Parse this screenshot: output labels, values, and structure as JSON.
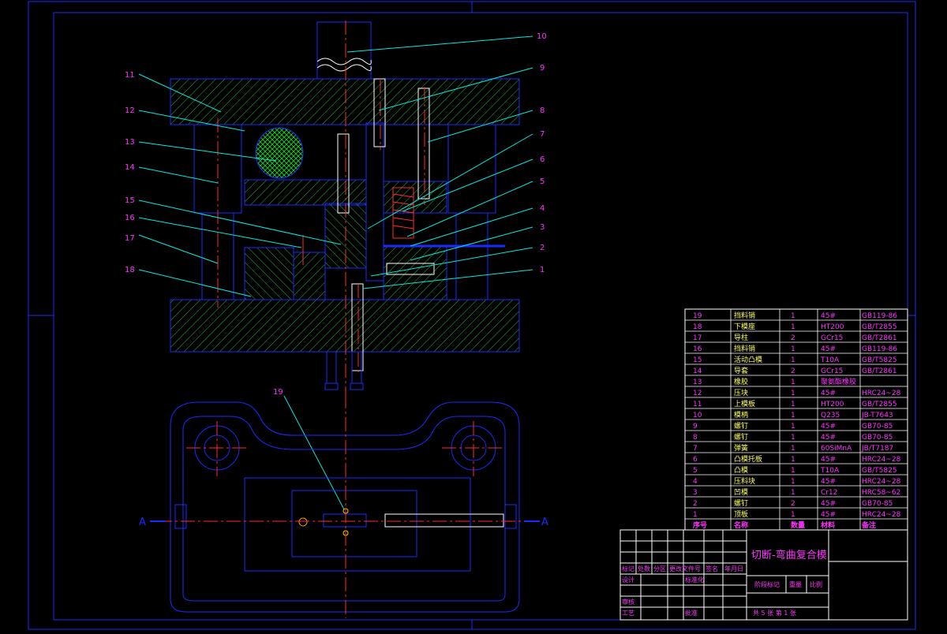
{
  "colors": {
    "background": "#000000",
    "frame": "#1a2bff",
    "hatch_green": "#22c02a",
    "leader": "#00e8e0",
    "label": "#ff33ff",
    "center_line": "#ff2a2a",
    "table_text_yellow": "#ffff66",
    "white": "#ffffff"
  },
  "callouts": [
    "1",
    "2",
    "3",
    "4",
    "5",
    "6",
    "7",
    "8",
    "9",
    "10",
    "11",
    "12",
    "13",
    "14",
    "15",
    "16",
    "17",
    "18",
    "19"
  ],
  "section_marks": {
    "left": "A",
    "right": "A"
  },
  "bom": {
    "header": {
      "no": "序号",
      "name": "名称",
      "qty": "数量",
      "material": "材料",
      "remark": "备注"
    },
    "rows": [
      {
        "no": "19",
        "name": "挡料销",
        "qty": "1",
        "material": "45#",
        "remark": "GB119-86"
      },
      {
        "no": "18",
        "name": "下模座",
        "qty": "1",
        "material": "HT200",
        "remark": "GB/T2855"
      },
      {
        "no": "17",
        "name": "导柱",
        "qty": "2",
        "material": "GCr15",
        "remark": "GB/T2861"
      },
      {
        "no": "16",
        "name": "挡料销",
        "qty": "1",
        "material": "45#",
        "remark": "GB119-86"
      },
      {
        "no": "15",
        "name": "活动凸模",
        "qty": "1",
        "material": "T10A",
        "remark": "GB/T5825"
      },
      {
        "no": "14",
        "name": "导套",
        "qty": "2",
        "material": "GCr15",
        "remark": "GB/T2861"
      },
      {
        "no": "13",
        "name": "橡胶",
        "qty": "1",
        "material": "聚氨酯橡胶",
        "remark": ""
      },
      {
        "no": "12",
        "name": "压块",
        "qty": "1",
        "material": "45#",
        "remark": "HRC24~28"
      },
      {
        "no": "11",
        "name": "上模板",
        "qty": "1",
        "material": "HT200",
        "remark": "GB/T2855"
      },
      {
        "no": "10",
        "name": "模柄",
        "qty": "1",
        "material": "Q235",
        "remark": "JB-T7643"
      },
      {
        "no": "9",
        "name": "螺钉",
        "qty": "1",
        "material": "45#",
        "remark": "GB70-85"
      },
      {
        "no": "8",
        "name": "螺钉",
        "qty": "1",
        "material": "45#",
        "remark": "GB70-85"
      },
      {
        "no": "7",
        "name": "弹簧",
        "qty": "1",
        "material": "60SiMnA",
        "remark": "JB/T7187"
      },
      {
        "no": "6",
        "name": "凸模托板",
        "qty": "1",
        "material": "45#",
        "remark": "HRC24~28"
      },
      {
        "no": "5",
        "name": "凸模",
        "qty": "1",
        "material": "T10A",
        "remark": "GB/T5825"
      },
      {
        "no": "4",
        "name": "压料块",
        "qty": "1",
        "material": "45#",
        "remark": "HRC24~28"
      },
      {
        "no": "3",
        "name": "凹模",
        "qty": "1",
        "material": "Cr12",
        "remark": "HRC58~62"
      },
      {
        "no": "2",
        "name": "螺钉",
        "qty": "2",
        "material": "45#",
        "remark": "GB70-85"
      },
      {
        "no": "1",
        "name": "顶板",
        "qty": "1",
        "material": "45#",
        "remark": "HRC24~28"
      }
    ]
  },
  "title_block": {
    "drawing_title": "切断-弯曲复合模",
    "rev_headers": [
      "标记",
      "处数",
      "分区",
      "更改文件号",
      "签名",
      "年月日"
    ],
    "design": "设计",
    "standardize": "标准化",
    "review": "审核",
    "process": "工艺",
    "approve": "批准",
    "stage_mark": "阶段标记",
    "weight": "重量",
    "scale": "比例",
    "sheets": "共 5 张  第 1 张"
  }
}
